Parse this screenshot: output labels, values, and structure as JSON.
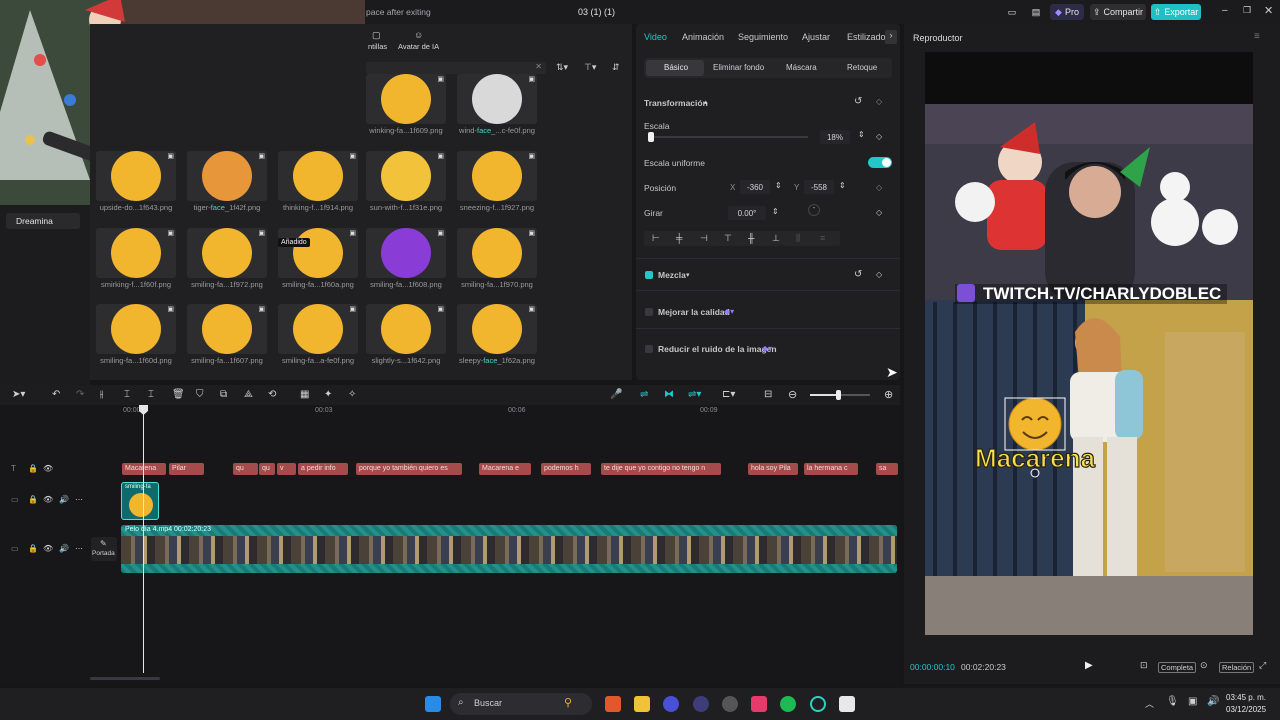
{
  "topbar": {
    "workspace_text": "pace after exiting",
    "project_title": "03 (1) (1)",
    "pro_label": "Pro",
    "share_label": "Compartir",
    "export_label": "Exportar",
    "accent_color": "#20c4c4"
  },
  "media": {
    "tab_templates": "ntillas",
    "tab_ai_avatar": "Avatar de IA",
    "sidebar_item": "Dreamina",
    "added_badge": "Añadido",
    "items": [
      {
        "pre": "winking-fa",
        "hl": "",
        "post": "...1f609.png"
      },
      {
        "pre": "wind-",
        "hl": "face",
        "post": "_...c-fe0f.png"
      },
      {
        "pre": "upside-do...1f643.png",
        "hl": "",
        "post": ""
      },
      {
        "pre": "tiger-",
        "hl": "face",
        "post": "_1f42f.png"
      },
      {
        "pre": "thinking-f...1f914.png",
        "hl": "",
        "post": ""
      },
      {
        "pre": "sun-with-f...1f31e.png",
        "hl": "",
        "post": ""
      },
      {
        "pre": "sneezing-f...1f927.png",
        "hl": "",
        "post": ""
      },
      {
        "pre": "smirking-f...1f60f.png",
        "hl": "",
        "post": ""
      },
      {
        "pre": "smiling-fa...1f972.png",
        "hl": "",
        "post": ""
      },
      {
        "pre": "smiling-fa...1f60a.png",
        "hl": "",
        "post": ""
      },
      {
        "pre": "smiling-fa...1f608.png",
        "hl": "",
        "post": ""
      },
      {
        "pre": "smiling-fa...1f970.png",
        "hl": "",
        "post": ""
      },
      {
        "pre": "smiling-fa...1f60d.png",
        "hl": "",
        "post": ""
      },
      {
        "pre": "smiling-fa...1f607.png",
        "hl": "",
        "post": ""
      },
      {
        "pre": "smiling-fa...a-fe0f.png",
        "hl": "",
        "post": ""
      },
      {
        "pre": "slightly-s...1f642.png",
        "hl": "",
        "post": ""
      },
      {
        "pre": "sleepy-",
        "hl": "face",
        "post": "_1f62a.png"
      }
    ]
  },
  "props": {
    "tabs": [
      "Video",
      "Animación",
      "Seguimiento",
      "Ajustar",
      "Estilizado"
    ],
    "subtabs": [
      "Básico",
      "Eliminar fondo",
      "Máscara",
      "Retoque"
    ],
    "transform_label": "Transformación",
    "scale_label": "Escala",
    "scale_value": "18%",
    "scale_fraction": 0.18,
    "uniform_label": "Escala uniforme",
    "position_label": "Posición",
    "pos_x_label": "X",
    "pos_x": "-360",
    "pos_y_label": "Y",
    "pos_y": "-558",
    "rotate_label": "Girar",
    "rotate_value": "0.00°",
    "blend_label": "Mezcla",
    "enhance_label": "Mejorar la calidad",
    "denoise_label": "Reducir el ruido de la imagen"
  },
  "player": {
    "title": "Reproductor",
    "overlay_text": "TWITCH.TV/CHARLYDOBLEC",
    "caption_text": "Macarena",
    "time_current": "00:00:00:10",
    "time_total": "00:02:20:23",
    "complete_label": "Completa",
    "ratio_label": "Relación"
  },
  "timeline": {
    "ruler": [
      "00:00",
      "00:03",
      "00:06",
      "00:09"
    ],
    "text_clips": [
      "Macarena",
      "Pilar",
      "qu",
      "qu",
      "v",
      "a pedir info",
      "porque yo también quiero es",
      "Macarena e",
      "podemos h",
      "te dije que yo contigo no tengo n",
      "hola soy Pila",
      "la hermana c",
      "sa"
    ],
    "sticker_clip": "smiling-fa",
    "video_clip": "Pelo día 4.mp4  00:02:20:23",
    "cover_label": "Portada"
  },
  "taskbar": {
    "search_placeholder": "Buscar",
    "time": "03:45 p. m.",
    "date": "03/12/2025"
  }
}
